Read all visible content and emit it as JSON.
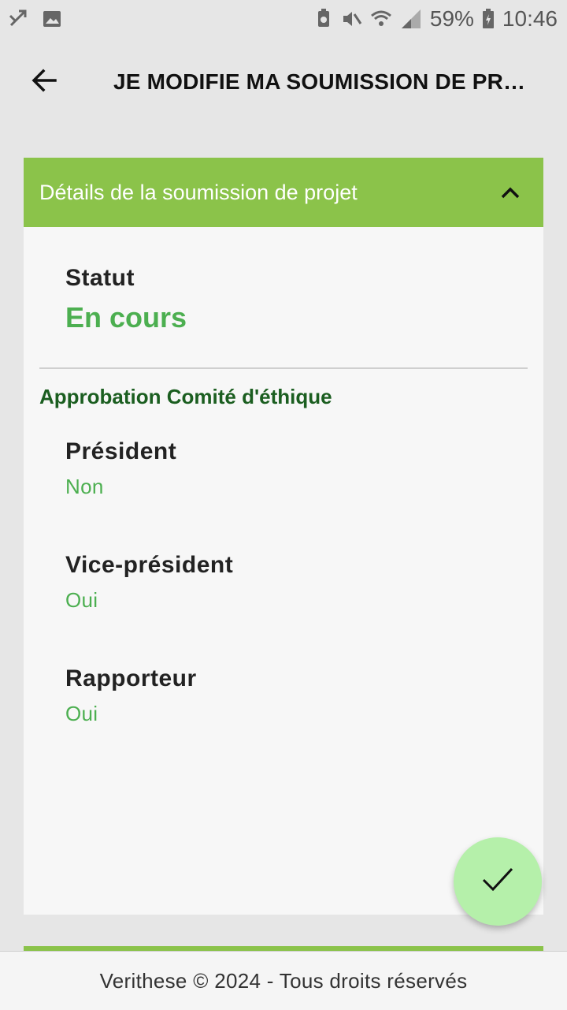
{
  "status_bar": {
    "battery": "59%",
    "time": "10:46",
    "icons": [
      "missed-call-icon",
      "image-icon",
      "battery-saver-icon",
      "mute-icon",
      "wifi-icon",
      "signal-icon",
      "battery-icon"
    ]
  },
  "app_bar": {
    "title": "JE MODIFIE MA SOUMISSION DE PROJ..."
  },
  "card": {
    "header_title": "Détails de la soumission de projet",
    "status": {
      "label": "Statut",
      "value": "En cours"
    },
    "section_title": "Approbation Comité d'éthique",
    "approvals": [
      {
        "label": "Président",
        "value": "Non"
      },
      {
        "label": "Vice-président",
        "value": "Oui"
      },
      {
        "label": "Rapporteur",
        "value": "Oui"
      }
    ]
  },
  "footer": {
    "text": "Verithese © 2024 - Tous droits réservés"
  },
  "colors": {
    "accent": "#8bc34a",
    "value_green": "#4caf50",
    "section_green": "#1b5e20",
    "fab": "#b5f0aa"
  }
}
